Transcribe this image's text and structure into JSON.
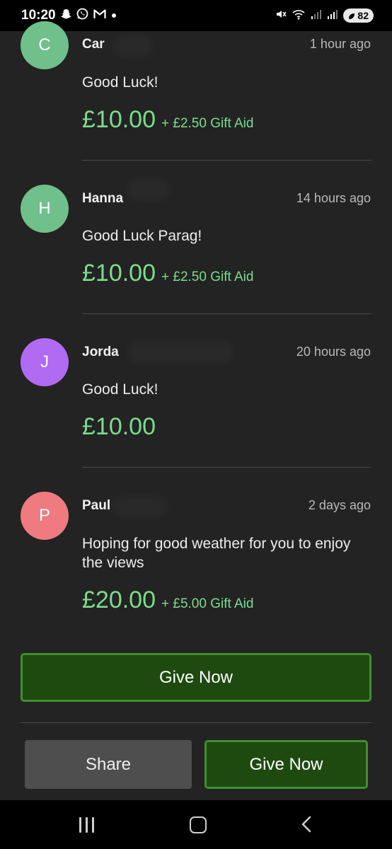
{
  "status_bar": {
    "time": "10:20",
    "left_icons": [
      "snapchat-icon",
      "whatsapp-icon",
      "gmail-icon",
      "dot-icon"
    ],
    "right_icons": [
      "mute-icon",
      "wifi-icon",
      "signal-icon",
      "signal-icon"
    ],
    "battery": "82"
  },
  "donations": [
    {
      "initial": "C",
      "name": "Car",
      "time": "1 hour ago",
      "message": "Good Luck!",
      "amount": "£10.00",
      "gift_aid": "+ £2.50 Gift Aid",
      "avatar_color": "#6fc08a"
    },
    {
      "initial": "H",
      "name": "Hanna",
      "time": "14 hours ago",
      "message": "Good Luck Parag!",
      "amount": "£10.00",
      "gift_aid": "+ £2.50 Gift Aid",
      "avatar_color": "#6fc08a"
    },
    {
      "initial": "J",
      "name": "Jorda",
      "time": "20 hours ago",
      "message": "Good Luck!",
      "amount": "£10.00",
      "gift_aid": "",
      "avatar_color": "#b16af2"
    },
    {
      "initial": "P",
      "name": "Paul",
      "time": "2 days ago",
      "message": "Hoping for good weather for you to enjoy the views",
      "amount": "£20.00",
      "gift_aid": "+ £5.00 Gift Aid",
      "avatar_color": "#ef7a80"
    }
  ],
  "actions": {
    "give_now_main": "Give Now",
    "share": "Share",
    "give_now_footer": "Give Now"
  },
  "colors": {
    "background": "#232323",
    "amount_green": "#7ddc8c",
    "button_green": "#1e4a10",
    "button_border": "#3f8f2e"
  },
  "nav_bar": {
    "icons": [
      "recents-icon",
      "home-icon",
      "back-icon"
    ]
  }
}
